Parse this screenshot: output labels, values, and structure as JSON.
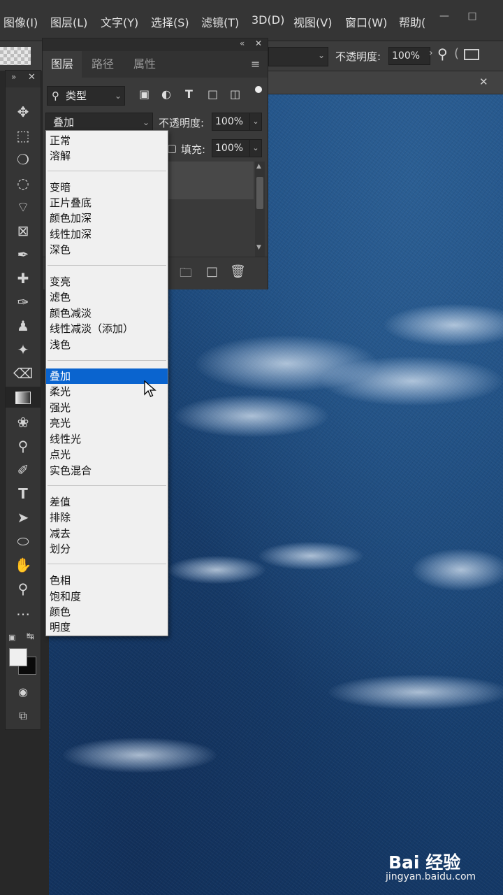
{
  "menubar": {
    "items": [
      "图像(I)",
      "图层(L)",
      "文字(Y)",
      "选择(S)",
      "滤镜(T)",
      "3D(D)",
      "视图(V)",
      "窗口(W)",
      "帮助("
    ]
  },
  "options_bar": {
    "opacity_label": "不透明度:",
    "opacity_value": "100%"
  },
  "layers_panel": {
    "tabs": [
      "图层",
      "路径",
      "属性"
    ],
    "filter_label": "类型",
    "blend_mode": "叠加",
    "opacity_label": "不透明度:",
    "opacity_value": "100%",
    "fill_label": "填充:",
    "fill_value": "100%"
  },
  "blend_menu": {
    "groups": [
      [
        "正常",
        "溶解"
      ],
      [
        "变暗",
        "正片叠底",
        "颜色加深",
        "线性加深",
        "深色"
      ],
      [
        "变亮",
        "滤色",
        "颜色减淡",
        "线性减淡（添加）",
        "浅色"
      ],
      [
        "叠加",
        "柔光",
        "强光",
        "亮光",
        "线性光",
        "点光",
        "实色混合"
      ],
      [
        "差值",
        "排除",
        "减去",
        "划分"
      ],
      [
        "色相",
        "饱和度",
        "颜色",
        "明度"
      ]
    ],
    "selected": "叠加"
  },
  "watermark": {
    "logo_text": "Bai 经验",
    "url": "jingyan.baidu.com"
  },
  "colors": {
    "highlight": "#0a64cf",
    "canvas_blue": "#1c4a7d"
  }
}
